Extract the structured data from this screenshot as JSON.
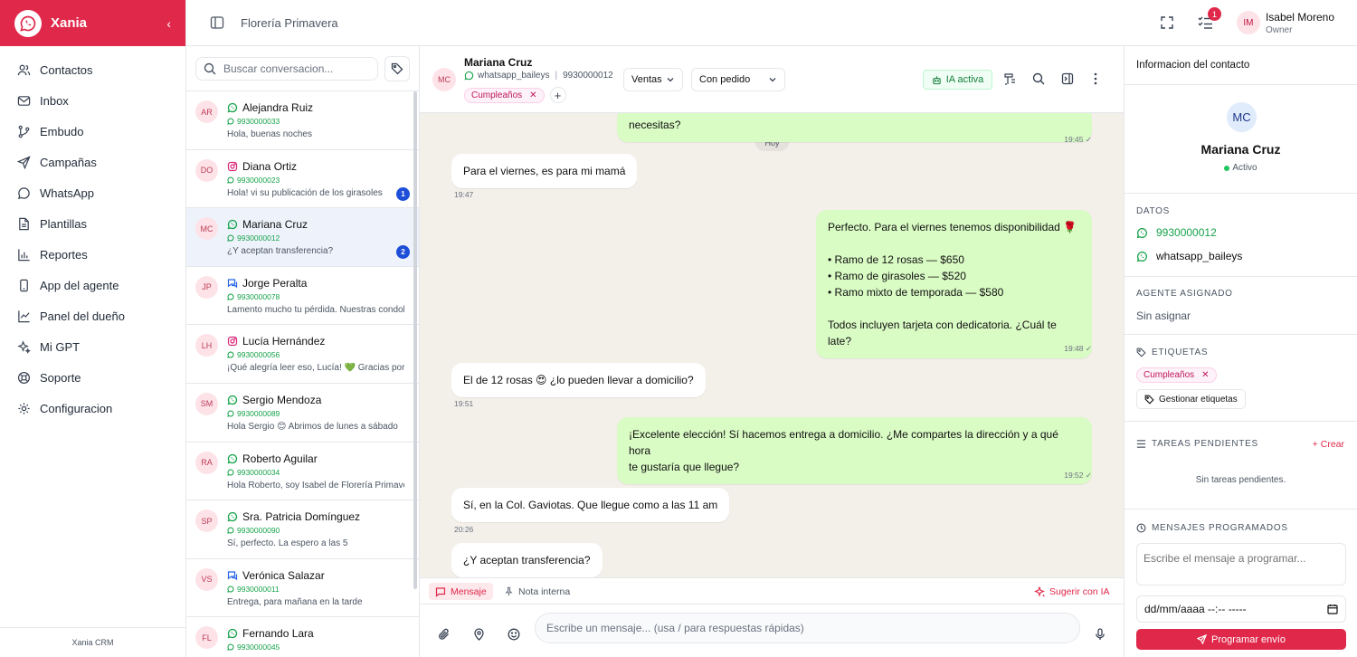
{
  "brand": {
    "name": "Xania",
    "footer": "Xania CRM",
    "color": "#e0284a"
  },
  "sidebar": {
    "items": [
      {
        "label": "Contactos",
        "icon": "users-icon"
      },
      {
        "label": "Inbox",
        "icon": "inbox-icon"
      },
      {
        "label": "Embudo",
        "icon": "funnel-icon"
      },
      {
        "label": "Campañas",
        "icon": "send-icon"
      },
      {
        "label": "WhatsApp",
        "icon": "whatsapp-icon"
      },
      {
        "label": "Plantillas",
        "icon": "file-icon"
      },
      {
        "label": "Reportes",
        "icon": "bar-chart-icon"
      },
      {
        "label": "App del agente",
        "icon": "phone-icon"
      },
      {
        "label": "Panel del dueño",
        "icon": "line-chart-icon"
      },
      {
        "label": "Mi GPT",
        "icon": "sparkle-icon"
      },
      {
        "label": "Soporte",
        "icon": "lifebuoy-icon"
      },
      {
        "label": "Configuracion",
        "icon": "gear-icon"
      }
    ]
  },
  "topbar": {
    "title": "Florería Primavera",
    "tasks_badge": "1",
    "user": {
      "initials": "IM",
      "name": "Isabel Moreno",
      "role": "Owner"
    }
  },
  "convlist": {
    "search_placeholder": "Buscar conversacion...",
    "items": [
      {
        "initials": "AR",
        "name": "Alejandra Ruiz",
        "channel": "whatsapp",
        "phone": "9930000033",
        "preview": "Hola, buenas noches",
        "unread": ""
      },
      {
        "initials": "DO",
        "name": "Diana Ortiz",
        "channel": "instagram",
        "phone": "9930000023",
        "preview": "Hola! vi su publicación de los girasoles",
        "unread": "1"
      },
      {
        "initials": "MC",
        "name": "Mariana Cruz",
        "channel": "whatsapp",
        "phone": "9930000012",
        "preview": "¿Y aceptan transferencia?",
        "unread": "2",
        "active": true
      },
      {
        "initials": "JP",
        "name": "Jorge Peralta",
        "channel": "messenger",
        "phone": "9930000078",
        "preview": "Lamento mucho tu pérdida. Nuestras condolencias",
        "unread": ""
      },
      {
        "initials": "LH",
        "name": "Lucía Hernández",
        "channel": "instagram",
        "phone": "9930000056",
        "preview": "¡Qué alegría leer eso, Lucía! 💚 Gracias por",
        "unread": ""
      },
      {
        "initials": "SM",
        "name": "Sergio Mendoza",
        "channel": "whatsapp",
        "phone": "9930000089",
        "preview": "Hola Sergio 😊 Abrimos de lunes a sábado",
        "unread": ""
      },
      {
        "initials": "RA",
        "name": "Roberto Aguilar",
        "channel": "whatsapp",
        "phone": "9930000034",
        "preview": "Hola Roberto, soy Isabel de Florería Primavera",
        "unread": ""
      },
      {
        "initials": "SP",
        "name": "Sra. Patricia Domínguez",
        "channel": "whatsapp",
        "phone": "9930000090",
        "preview": "Sí, perfecto. La espero a las 5",
        "unread": ""
      },
      {
        "initials": "VS",
        "name": "Verónica Salazar",
        "channel": "messenger",
        "phone": "9930000011",
        "preview": "Entrega, para mañana en la tarde",
        "unread": ""
      },
      {
        "initials": "FL",
        "name": "Fernando Lara",
        "channel": "whatsapp",
        "phone": "9930000045",
        "preview": "",
        "unread": ""
      }
    ]
  },
  "chat": {
    "contact": {
      "initials": "MC",
      "name": "Mariana Cruz",
      "account": "whatsapp_baileys",
      "phone": "9930000012",
      "tag": "Cumpleaños"
    },
    "pipeline": "Ventas",
    "stage": "Con pedido",
    "ia_label": "IA activa",
    "day_label": "Hoy",
    "messages": [
      {
        "dir": "out",
        "text": "necesitas?",
        "time": "19:45 ✓"
      },
      {
        "dir": "in",
        "text": "Para el viernes, es para mi mamá",
        "time": "19:47"
      },
      {
        "dir": "out",
        "lines": [
          "Perfecto. Para el viernes tenemos disponibilidad 🌹",
          "",
          "• Ramo de 12 rosas — $650",
          "• Ramo de girasoles — $520",
          "• Ramo mixto de temporada — $580",
          "",
          "Todos incluyen tarjeta con dedicatoria. ¿Cuál te late?"
        ],
        "time": "19:48 ✓"
      },
      {
        "dir": "in",
        "text": "El de 12 rosas 😍 ¿lo pueden llevar a domicilio?",
        "time": "19:51"
      },
      {
        "dir": "out",
        "lines": [
          "¡Excelente elección! Sí hacemos entrega a domicilio. ¿Me compartes la dirección y a qué hora",
          "te gustaría que llegue?"
        ],
        "time": "19:52 ✓"
      },
      {
        "dir": "in",
        "text": "Sí, en la Col. Gaviotas. Que llegue como a las 11 am",
        "time": "20:26"
      },
      {
        "dir": "in",
        "text": "¿Y aceptan transferencia?",
        "time": ""
      }
    ],
    "tabs": {
      "message": "Mensaje",
      "note": "Nota interna",
      "suggest": "Sugerir con IA"
    },
    "composer_placeholder": "Escribe un mensaje... (usa / para respuestas rápidas)"
  },
  "contact_panel": {
    "title": "Informacion del contacto",
    "initials": "MC",
    "name": "Mariana Cruz",
    "status": "Activo",
    "datos_title": "DATOS",
    "phone": "9930000012",
    "account": "whatsapp_baileys",
    "agent_title": "AGENTE ASIGNADO",
    "agent_value": "Sin asignar",
    "tags_title": "ETIQUETAS",
    "tag": "Cumpleaños",
    "manage_tags": "Gestionar etiquetas",
    "tasks_title": "TAREAS PENDIENTES",
    "tasks_create": "Crear",
    "tasks_empty": "Sin tareas pendientes.",
    "scheduled_title": "MENSAJES PROGRAMADOS",
    "scheduled_placeholder": "Escribe el mensaje a programar...",
    "date_placeholder": "dd/mm/aaaa --:-- -----",
    "send_button": "Programar envío"
  }
}
